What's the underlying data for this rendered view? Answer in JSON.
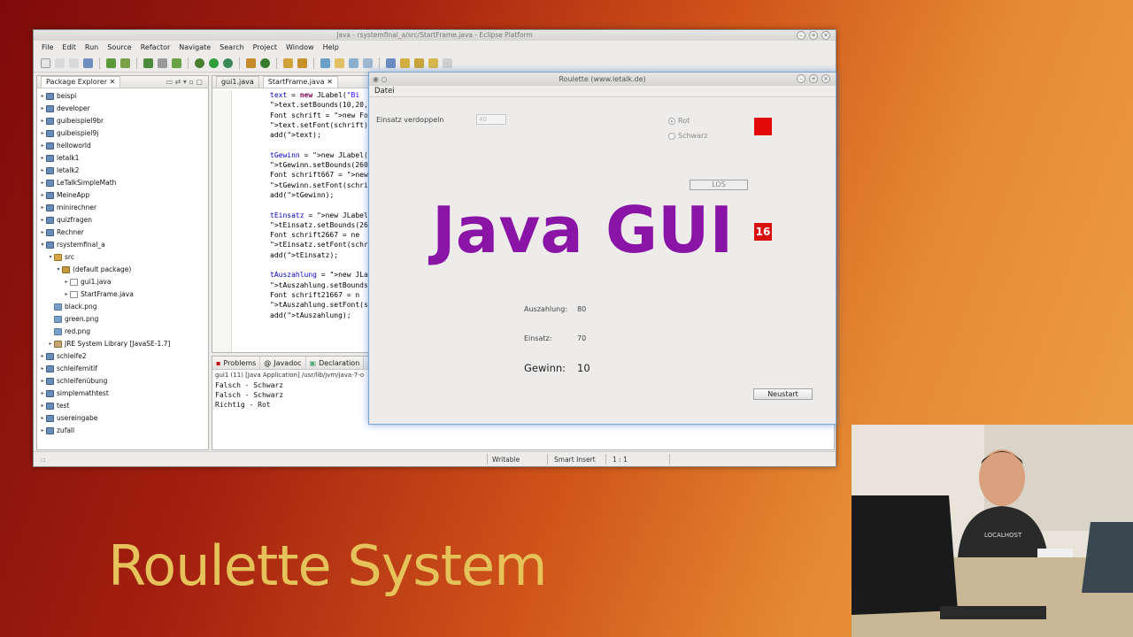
{
  "eclipse": {
    "title": "Java - rsystemfinal_a/src/StartFrame.java - Eclipse Platform",
    "menu": [
      "File",
      "Edit",
      "Run",
      "Source",
      "Refactor",
      "Navigate",
      "Search",
      "Project",
      "Window",
      "Help"
    ],
    "package_explorer": {
      "tab": "Package Explorer",
      "items": [
        {
          "label": "beispi",
          "type": "proj",
          "depth": 0
        },
        {
          "label": "developer",
          "type": "proj",
          "depth": 0
        },
        {
          "label": "guibeispiel9br",
          "type": "proj",
          "depth": 0
        },
        {
          "label": "guibeispiel9j",
          "type": "proj",
          "depth": 0
        },
        {
          "label": "helloworld",
          "type": "proj",
          "depth": 0
        },
        {
          "label": "letalk1",
          "type": "proj",
          "depth": 0
        },
        {
          "label": "letalk2",
          "type": "proj",
          "depth": 0
        },
        {
          "label": "LeTalkSimpleMath",
          "type": "proj",
          "depth": 0
        },
        {
          "label": "MeineApp",
          "type": "proj",
          "depth": 0
        },
        {
          "label": "minirechner",
          "type": "proj",
          "depth": 0
        },
        {
          "label": "quizfragen",
          "type": "proj",
          "depth": 0
        },
        {
          "label": "Rechner",
          "type": "proj",
          "depth": 0
        },
        {
          "label": "rsystemfinal_a",
          "type": "proj",
          "depth": 0
        },
        {
          "label": "src",
          "type": "src",
          "depth": 1
        },
        {
          "label": "(default package)",
          "type": "pkg",
          "depth": 2
        },
        {
          "label": "gui1.java",
          "type": "java",
          "depth": 3
        },
        {
          "label": "StartFrame.java",
          "type": "java",
          "depth": 3
        },
        {
          "label": "black.png",
          "type": "img",
          "depth": 1
        },
        {
          "label": "green.png",
          "type": "img",
          "depth": 1
        },
        {
          "label": "red.png",
          "type": "img",
          "depth": 1
        },
        {
          "label": "JRE System Library [JavaSE-1.7]",
          "type": "lib",
          "depth": 1
        },
        {
          "label": "schleife2",
          "type": "proj",
          "depth": 0
        },
        {
          "label": "schleifemitif",
          "type": "proj",
          "depth": 0
        },
        {
          "label": "schleifenübung",
          "type": "proj",
          "depth": 0
        },
        {
          "label": "simplemathtest",
          "type": "proj",
          "depth": 0
        },
        {
          "label": "test",
          "type": "proj",
          "depth": 0
        },
        {
          "label": "usereingabe",
          "type": "proj",
          "depth": 0
        },
        {
          "label": "zufall",
          "type": "proj",
          "depth": 0
        }
      ]
    },
    "editor_tabs": [
      "gui1.java",
      "StartFrame.java"
    ],
    "code_lines": [
      "text = new JLabel(\"Bi",
      "text.setBounds(10,20,",
      "Font schrift = new Fo",
      "text.setFont(schrift)",
      "add(text);",
      "",
      "tGewinn = new JLabel(",
      "tGewinn.setBounds(260",
      "Font schrift667 = new",
      "tGewinn.setFont(schri",
      "add(tGewinn);",
      "",
      "tEinsatz = new JLabel",
      "tEinsatz.setBounds(26",
      "Font schrift2667 = ne",
      "tEinsatz.setFont(schr",
      "add(tEinsatz);",
      "",
      "tAuszahlung = new JLa",
      "tAuszahlung.setBounds",
      "Font schrift21667 = n",
      "tAuszahlung.setFont(s",
      "add(tAuszahlung);"
    ],
    "console": {
      "tabs": [
        "Problems",
        "Javadoc",
        "Declaration"
      ],
      "info": "gui1 (11) [Java Application] /usr/lib/jvm/java-7-o",
      "lines": [
        "Falsch - Schwarz",
        "Falsch - Schwarz",
        "Richtig - Rot"
      ]
    },
    "status": {
      "writable": "Writable",
      "insert": "Smart Insert",
      "position": "1 : 1"
    }
  },
  "roulette": {
    "title": "Roulette (www.letalk.de)",
    "menu": "Datei",
    "einsatz_label": "Einsatz verdoppeln",
    "einsatz_value": "40",
    "radio_rot": "Rot",
    "radio_schwarz": "Schwarz",
    "los_button": "LOS",
    "number": "16",
    "auszahlung_label": "Auszahlung:",
    "auszahlung_value": "80",
    "einsatz2_label": "Einsatz:",
    "einsatz2_value": "70",
    "gewinn_label": "Gewinn:",
    "gewinn_value": "10",
    "neustart_button": "Neustart",
    "accent_red": "#e20a0a"
  },
  "overlay": {
    "headline": "Java GUI",
    "footer": "Roulette System"
  }
}
